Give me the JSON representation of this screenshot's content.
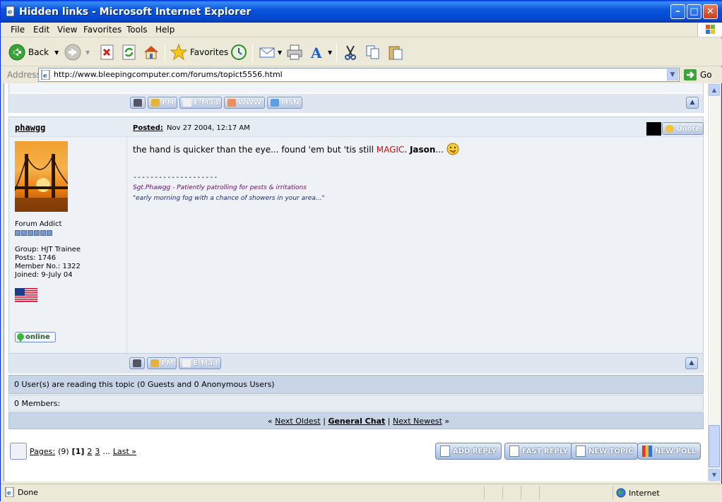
{
  "window": {
    "title": "Hidden links - Microsoft Internet Explorer",
    "min_glyph": "–",
    "max_glyph": "□",
    "close_glyph": "✕"
  },
  "menu": [
    "File",
    "Edit",
    "View",
    "Favorites",
    "Tools",
    "Help"
  ],
  "toolbar": {
    "back_label": "Back",
    "favorites_label": "Favorites"
  },
  "address": {
    "label": "Address",
    "url": "http://www.bleepingcomputer.com/forums/topict5556.html",
    "go_label": "Go"
  },
  "prev_post": {
    "buttons": [
      "PM",
      "E-Mail",
      "WWW",
      "MSN"
    ]
  },
  "post": {
    "author": "phawgg",
    "posted_label": "Posted:",
    "posted_date": "Nov 27 2004, 12:17 AM",
    "quote_label": "Quote",
    "user_title": "Forum Addict",
    "group": "Group: HJT Trainee",
    "posts": "Posts: 1746",
    "member_no": "Member No.: 1322",
    "joined": "Joined: 9-July 04",
    "online_label": "online",
    "body_part1": "the hand is quicker than the eye... found 'em but 'tis still ",
    "body_magic": "MAGIC",
    "body_part2": ". ",
    "body_jason": "Jason",
    "body_part3": "... ",
    "sig_rule": "--------------------",
    "sig_line1": "Sgt.Phawgg - Patiently patrolling for pests & irritations",
    "sig_line2": "\"early morning fog with a chance of showers in your area...\"",
    "buttons": [
      "PM",
      "E-Mail"
    ]
  },
  "stats": {
    "readers": "0 User(s) are reading this topic (0 Guests and 0 Anonymous Users)",
    "members": "0 Members:"
  },
  "topic_nav": {
    "prefix": "«",
    "next_oldest": "Next Oldest",
    "forum": "General Chat",
    "next_newest": "Next Newest",
    "suffix": "»"
  },
  "pagination": {
    "label": "Pages:",
    "count": "(9)",
    "current": "[1]",
    "pages": [
      "2",
      "3"
    ],
    "ellipsis": "...",
    "last": "Last »"
  },
  "actions": {
    "add_reply": "ADD REPLY",
    "fast_reply": "FAST REPLY",
    "new_topic": "NEW TOPIC",
    "new_poll": "NEW POLL"
  },
  "status": {
    "text": "Done",
    "zone": "Internet"
  },
  "colors": {
    "titlebar": "#0855dd",
    "forum_bar": "#dfe6ef",
    "stat_row": "#c8d5e6",
    "magic": "#d01010"
  }
}
